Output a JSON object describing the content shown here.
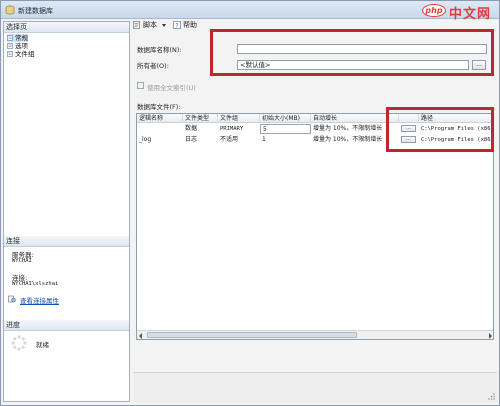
{
  "window": {
    "title": "新建数据库"
  },
  "watermark": {
    "brand_php": "php",
    "brand_cn": "中文网"
  },
  "left_panel": {
    "select_page_header": "选择页",
    "pages": [
      {
        "label": "常规",
        "selected": true
      },
      {
        "label": "选项",
        "selected": false
      },
      {
        "label": "文件组",
        "selected": false
      }
    ],
    "connection_header": "连接",
    "server_label": "服务器:",
    "server_value": "WYCHAI",
    "connection_label": "连接:",
    "connection_value": "WYCHAI\\xlszhai",
    "view_connection_link": "查看连接属性",
    "progress_header": "进度",
    "progress_status": "就绪"
  },
  "toolbar": {
    "script_label": "脚本",
    "help_label": "帮助"
  },
  "form": {
    "db_name_label": "数据库名称(N):",
    "db_name_value": "",
    "owner_label": "所有者(O):",
    "owner_value": "<默认值>",
    "owner_browse": "...",
    "fulltext_label": "使用全文索引(U)",
    "fulltext_checked": false,
    "files_label": "数据库文件(F):"
  },
  "grid": {
    "columns": [
      "逻辑名称",
      "文件类型",
      "文件组",
      "初始大小(MB)",
      "自动增长",
      "",
      "路径"
    ],
    "rows": [
      {
        "logical_name": "",
        "file_type": "数据",
        "filegroup": "PRIMARY",
        "initial_size": "5",
        "autogrowth": "增量为 10%，不限制增长",
        "path": "C:\\Program Files (x86)"
      },
      {
        "logical_name": "_log",
        "file_type": "日志",
        "filegroup": "不适用",
        "initial_size": "1",
        "autogrowth": "增量为 10%，不限制增长",
        "path": "C:\\Program Files (x86)"
      }
    ],
    "cell_button": "..."
  },
  "colors": {
    "highlight_red": "#c0262d",
    "link_blue": "#1550b0",
    "brand_red": "#e23b3b"
  }
}
